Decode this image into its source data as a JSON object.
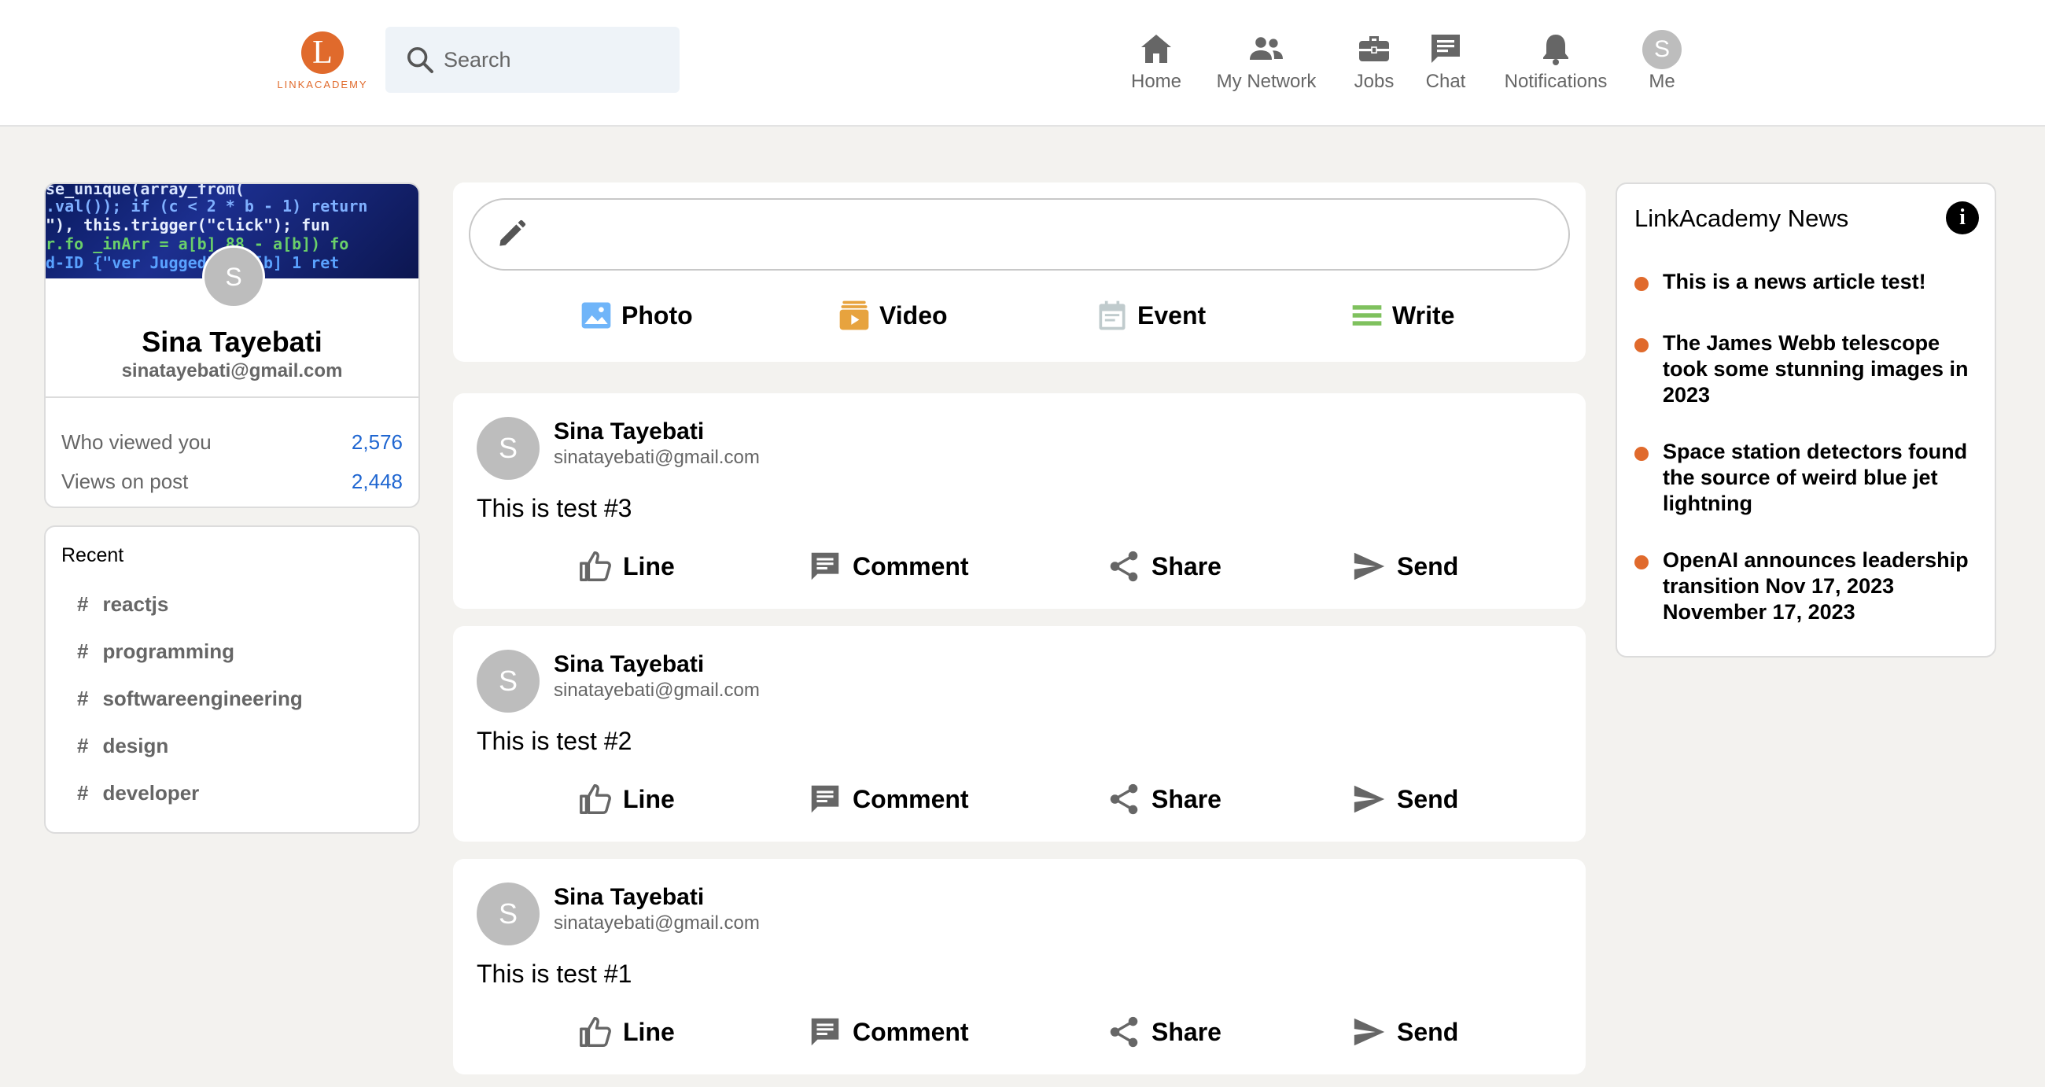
{
  "header": {
    "logo_letter": "L",
    "logo_text": "LINKACADEMY",
    "search_placeholder": "Search",
    "nav": [
      {
        "label": "Home",
        "icon": "home-icon"
      },
      {
        "label": "My Network",
        "icon": "network-icon"
      },
      {
        "label": "Jobs",
        "icon": "briefcase-icon"
      },
      {
        "label": "Chat",
        "icon": "chat-icon"
      },
      {
        "label": "Notifications",
        "icon": "bell-icon"
      },
      {
        "label": "Me",
        "icon": "avatar",
        "avatar_letter": "S"
      }
    ]
  },
  "profile": {
    "avatar_letter": "S",
    "name": "Sina Tayebati",
    "email": "sinatayebati@gmail.com",
    "stats": [
      {
        "label": "Who viewed you",
        "value": "2,576"
      },
      {
        "label": "Views on post",
        "value": "2,448"
      }
    ]
  },
  "recent": {
    "title": "Recent",
    "items": [
      {
        "hash": "#",
        "label": "reactjs"
      },
      {
        "hash": "#",
        "label": "programming"
      },
      {
        "hash": "#",
        "label": "softwareengineering"
      },
      {
        "hash": "#",
        "label": "design"
      },
      {
        "hash": "#",
        "label": "developer"
      }
    ]
  },
  "share": {
    "options": [
      {
        "label": "Photo",
        "icon": "photo-icon",
        "color": "#70b5f9"
      },
      {
        "label": "Video",
        "icon": "video-icon",
        "color": "#e7a33e"
      },
      {
        "label": "Event",
        "icon": "calendar-icon",
        "color": "#c0cbcd"
      },
      {
        "label": "Write",
        "icon": "article-icon",
        "color": "#7fc15e"
      }
    ]
  },
  "posts": [
    {
      "avatar_letter": "S",
      "name": "Sina Tayebati",
      "email": "sinatayebati@gmail.com",
      "text": "This is test #3"
    },
    {
      "avatar_letter": "S",
      "name": "Sina Tayebati",
      "email": "sinatayebati@gmail.com",
      "text": "This is test #2"
    },
    {
      "avatar_letter": "S",
      "name": "Sina Tayebati",
      "email": "sinatayebati@gmail.com",
      "text": "This is test #1"
    }
  ],
  "post_actions": [
    {
      "label": "Line",
      "icon": "thumbs-up-icon"
    },
    {
      "label": "Comment",
      "icon": "comment-icon"
    },
    {
      "label": "Share",
      "icon": "share-icon"
    },
    {
      "label": "Send",
      "icon": "send-icon"
    }
  ],
  "news": {
    "title": "LinkAcademy News",
    "items": [
      "This is a news article test!",
      "The James Webb telescope took some stunning images in 2023",
      "Space station detectors found the source of weird blue jet lightning",
      "OpenAI announces leadership transition Nov 17, 2023 November 17, 2023"
    ]
  },
  "colors": {
    "accent": "#e06a2c",
    "stat_value": "#1f66d1",
    "page_background": "#f3f2ef"
  }
}
